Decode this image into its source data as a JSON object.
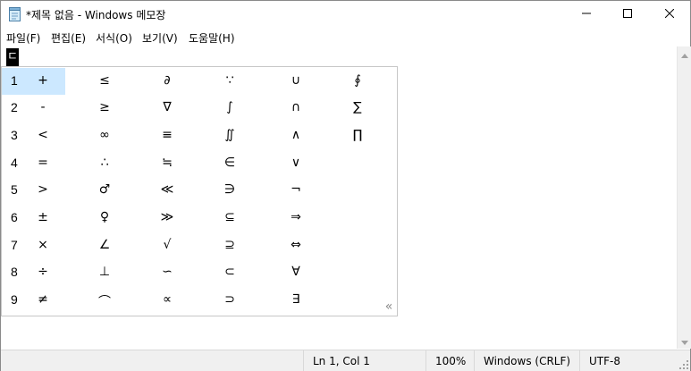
{
  "window": {
    "title": "*제목 없음 - Windows 메모장"
  },
  "titlebar": {
    "app_icon": "notepad-icon",
    "minimize_icon": "minimize-icon",
    "maximize_icon": "maximize-icon",
    "close_icon": "close-icon"
  },
  "menu": {
    "items": [
      {
        "label": "파일(F)"
      },
      {
        "label": "편집(E)"
      },
      {
        "label": "서식(O)"
      },
      {
        "label": "보기(V)"
      },
      {
        "label": "도움말(H)"
      }
    ]
  },
  "editor": {
    "composing_text": "ㄷ"
  },
  "candidates": {
    "rows": [
      {
        "num": "1",
        "symbols": [
          "+",
          "≤",
          "∂",
          "∵",
          "∪",
          "∮"
        ]
      },
      {
        "num": "2",
        "symbols": [
          "-",
          "≥",
          "∇",
          "∫",
          "∩",
          "∑"
        ]
      },
      {
        "num": "3",
        "symbols": [
          "<",
          "∞",
          "≡",
          "∬",
          "∧",
          "∏"
        ]
      },
      {
        "num": "4",
        "symbols": [
          "=",
          "∴",
          "≒",
          "∈",
          "∨",
          ""
        ]
      },
      {
        "num": "5",
        "symbols": [
          ">",
          "♂",
          "≪",
          "∋",
          "¬",
          ""
        ]
      },
      {
        "num": "6",
        "symbols": [
          "±",
          "♀",
          "≫",
          "⊆",
          "⇒",
          ""
        ]
      },
      {
        "num": "7",
        "symbols": [
          "×",
          "∠",
          "√",
          "⊇",
          "⇔",
          ""
        ]
      },
      {
        "num": "8",
        "symbols": [
          "÷",
          "⊥",
          "∽",
          "⊂",
          "∀",
          ""
        ]
      },
      {
        "num": "9",
        "symbols": [
          "≠",
          "⌒",
          "∝",
          "⊃",
          "∃",
          ""
        ]
      }
    ],
    "selected_index": 0,
    "more_label": "«"
  },
  "status": {
    "position": "Ln 1, Col 1",
    "zoom": "100%",
    "line_ending": "Windows (CRLF)",
    "encoding": "UTF-8"
  },
  "colors": {
    "selection_highlight": "#cce8ff",
    "statusbar_bg": "#f0f0f0"
  }
}
